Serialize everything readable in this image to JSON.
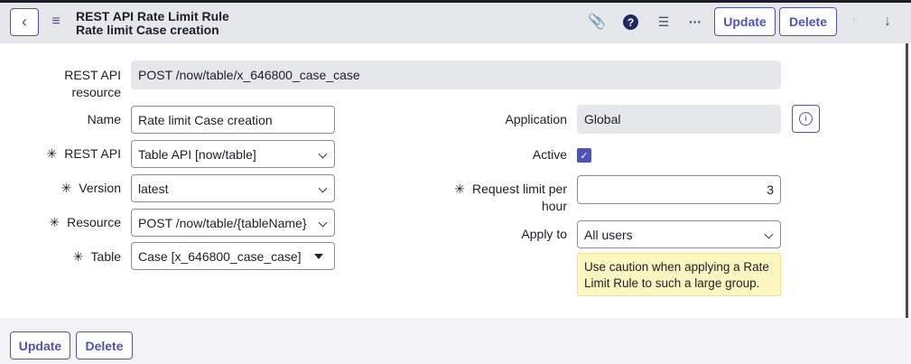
{
  "header": {
    "title": "REST API Rate Limit Rule",
    "subtitle": "Rate limit Case creation",
    "update_label": "Update",
    "delete_label": "Delete"
  },
  "form": {
    "rest_api_resource": {
      "label": "REST API resource",
      "value": "POST /now/table/x_646800_case_case"
    },
    "name": {
      "label": "Name",
      "value": "Rate limit Case creation"
    },
    "rest_api": {
      "label": "REST API",
      "value": "Table API [now/table]"
    },
    "version": {
      "label": "Version",
      "value": "latest"
    },
    "resource": {
      "label": "Resource",
      "value": "POST /now/table/{tableName}"
    },
    "table": {
      "label": "Table",
      "value": "Case [x_646800_case_case]"
    },
    "application": {
      "label": "Application",
      "value": "Global"
    },
    "active": {
      "label": "Active",
      "checked": true
    },
    "request_limit": {
      "label": "Request limit per hour",
      "value": "3"
    },
    "apply_to": {
      "label": "Apply to",
      "value": "All users"
    },
    "warning": "Use caution when applying a Rate Limit Rule to such a large group.",
    "required_mark": "✳"
  },
  "footer": {
    "update_label": "Update",
    "delete_label": "Delete"
  },
  "colors": {
    "accent": "#4f52bd",
    "header_bg": "#e6e7eb",
    "warning_bg": "#fcf7c0"
  }
}
